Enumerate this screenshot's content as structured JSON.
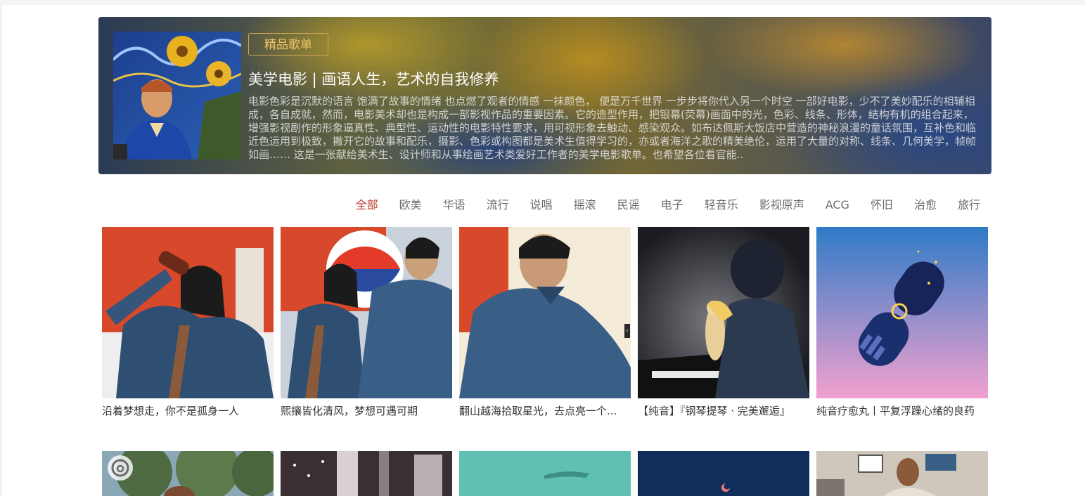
{
  "banner": {
    "badge": "精品歌单",
    "title": "美学电影 | 画语人生，艺术的自我修养",
    "description": "电影色彩是沉默的语言 饱满了故事的情绪 也点燃了观者的情感 一抹颜色， 便是万千世界 一步步将你代入另一个时空 一部好电影，少不了美妙配乐的相辅相成，各自成就，然而，电影美术却也是构成一部影视作品的重要因素。它的造型作用，把银幕(荧幕)画面中的光，色彩、线条、形体，结构有机的组合起来，增强影视剧作的形象逼真性、典型性、运动性的电影特性要求，用可视形象去触动、感染观众。如布达佩斯大饭店中营造的神秘浪漫的童话氛围，互补色和临近色运用到极致，撇开它的故事和配乐，摄影、色彩或构图都是美术生值得学习的，亦或者海洋之歌的精美绝伦，运用了大量的对称、线条、几何美学，帧帧如画…… 这是一张献给美术生、设计师和从事绘画艺术类爱好工作者的美学电影歌单。也希望各位看官能.."
  },
  "tabs": [
    "全部",
    "欧美",
    "华语",
    "流行",
    "说唱",
    "摇滚",
    "民谣",
    "电子",
    "轻音乐",
    "影视原声",
    "ACG",
    "怀旧",
    "治愈",
    "旅行"
  ],
  "active_tab": "全部",
  "playlists": [
    {
      "title": "沿着梦想走，你不是孤身一人"
    },
    {
      "title": "熙攘皆化清风，梦想可遇可期"
    },
    {
      "title": "翻山越海拾取星光，去点亮一个..."
    },
    {
      "title": "【纯音】『钢琴提琴 · 完美邂逅』"
    },
    {
      "title": "纯音疗愈丸丨平复浮躁心绪的良药"
    }
  ],
  "icons": {
    "carousel_arrow": "chevron-left-icon",
    "netease": "netease-music-icon"
  },
  "colors": {
    "accent": "#c0392b",
    "badge": "#f0c463"
  }
}
